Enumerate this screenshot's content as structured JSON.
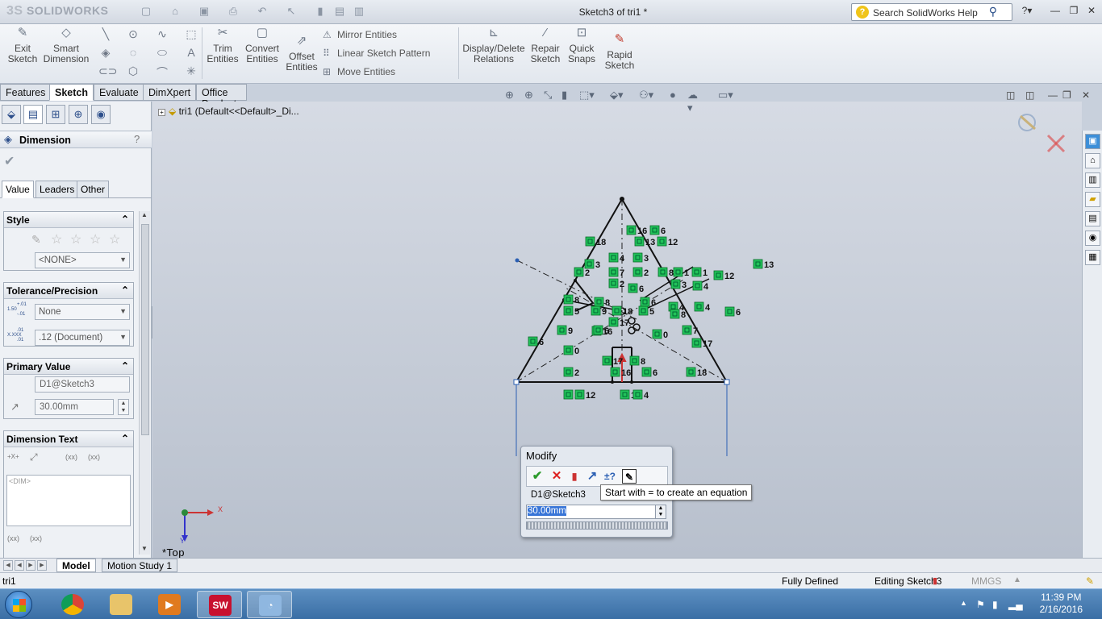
{
  "app": {
    "logo": "SOLIDWORKS",
    "logo_ds": "3S",
    "title": "Sketch3 of tri1 *",
    "help_placeholder": "Search SolidWorks Help"
  },
  "command_manager": {
    "exit_sketch": "Exit Sketch",
    "smart_dimension": "Smart Dimension",
    "trim_entities": "Trim Entities",
    "convert_entities": "Convert Entities",
    "offset_entities": "Offset Entities",
    "mirror_entities": "Mirror Entities",
    "linear_sketch_pattern": "Linear Sketch Pattern",
    "move_entities": "Move Entities",
    "display_delete_relations": "Display/Delete Relations",
    "repair_sketch": "Repair Sketch",
    "quick_snaps": "Quick Snaps",
    "rapid_sketch": "Rapid Sketch"
  },
  "tabs": [
    "Features",
    "Sketch",
    "Evaluate",
    "DimXpert",
    "Office Products"
  ],
  "active_tab": "Sketch",
  "property_manager": {
    "title": "Dimension",
    "tabs": [
      "Value",
      "Leaders",
      "Other"
    ],
    "style": {
      "header": "Style",
      "favorite": "<NONE>"
    },
    "tolerance": {
      "header": "Tolerance/Precision",
      "tolerance_type": "None",
      "precision": ".12 (Document)",
      "icon1_top": "+.01",
      "icon1_mid": "1.50",
      "icon1_bot": "-.01",
      "icon2_top": ".01",
      "icon2_mid": "X.XXX",
      "icon2_bot": ".01"
    },
    "primary_value": {
      "header": "Primary Value",
      "name": "D1@Sketch3",
      "value": "30.00mm"
    },
    "dimension_text": {
      "header": "Dimension Text",
      "text": "<DIM>",
      "sym_xx1": "(xx)",
      "sym_xx2": "(xx)",
      "sym_xx3": "(xx)",
      "sym_xx4": "(xx)",
      "sym_x": "+X+"
    }
  },
  "tree": {
    "item": "tri1  (Default<<Default>_Di..."
  },
  "view": {
    "orientation": "*Top",
    "axis_x": "X",
    "axis_y": "Y"
  },
  "sketch_relation_labels": [
    "16",
    "6",
    "18",
    "13",
    "12",
    "13",
    "4",
    "3",
    "2",
    "7",
    "2",
    "8",
    "1",
    "1",
    "12",
    "2",
    "3",
    "4",
    "8",
    "8",
    "6",
    "6",
    "4",
    "4",
    "5",
    "9",
    "18",
    "5",
    "6",
    "16",
    "8",
    "6",
    "9",
    "6",
    "0",
    "7",
    "17",
    "17",
    "0",
    "17",
    "8",
    "2"
  ],
  "modify_dialog": {
    "title": "Modify",
    "dimension_name": "D1@Sketch3",
    "value": "30.00mm",
    "tooltip": "Start with = to create an equation"
  },
  "bottom_tabs": [
    "Model",
    "Motion Study 1"
  ],
  "status": {
    "left": "tri1",
    "state": "Fully Defined",
    "mode": "Editing Sketch3",
    "units": "MMGS"
  },
  "taskbar": {
    "time": "11:39 PM",
    "date": "2/16/2016",
    "apps": [
      "chrome",
      "explorer",
      "media",
      "solidworks",
      "paint"
    ]
  },
  "colors": {
    "relation_fill": "#22c35a",
    "sketch_line": "#111111",
    "selected_dimension": "#2b5fb3",
    "accent": "#3875d7"
  }
}
